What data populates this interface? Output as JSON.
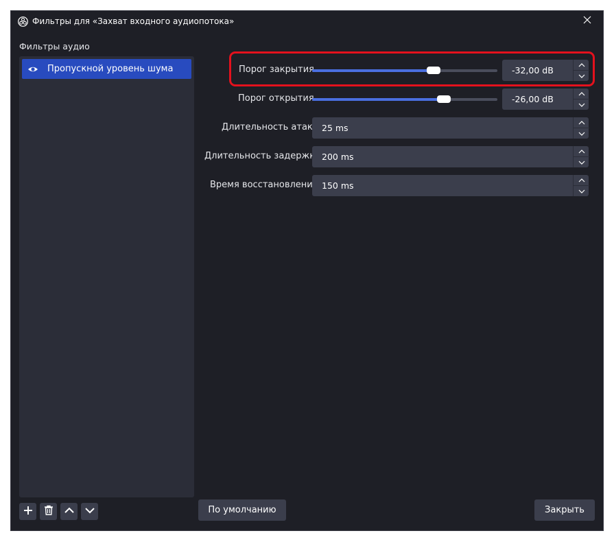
{
  "window": {
    "title": "Фильтры для «Захват входного аудиопотока»"
  },
  "sidebar": {
    "section_label": "Фильтры аудио",
    "items": [
      {
        "label": "Пропускной уровень шума",
        "visible": true,
        "selected": true
      }
    ],
    "toolbar_icons": [
      "plus-icon",
      "trash-icon",
      "chevron-up-icon",
      "chevron-down-icon"
    ]
  },
  "settings": {
    "close_threshold": {
      "label": "Порог закрытия",
      "value": "-32,00 dB",
      "slider_fraction": 0.655
    },
    "open_threshold": {
      "label": "Порог открытия",
      "value": "-26,00 dB",
      "slider_fraction": 0.71
    },
    "attack_time": {
      "label": "Длительность атаки",
      "value": "25 ms"
    },
    "hold_time": {
      "label": "Длительность задержки",
      "value": "200 ms"
    },
    "release_time": {
      "label": "Время восстановления",
      "value": "150 ms"
    }
  },
  "footer": {
    "defaults_label": "По умолчанию",
    "close_label": "Закрыть"
  },
  "colors": {
    "window_bg": "#1e1f26",
    "panel_bg": "#2b2d38",
    "control_bg": "#3b3e4c",
    "selection": "#284bbf",
    "slider_fill": "#4a6fe0",
    "highlight": "#e4111d"
  }
}
